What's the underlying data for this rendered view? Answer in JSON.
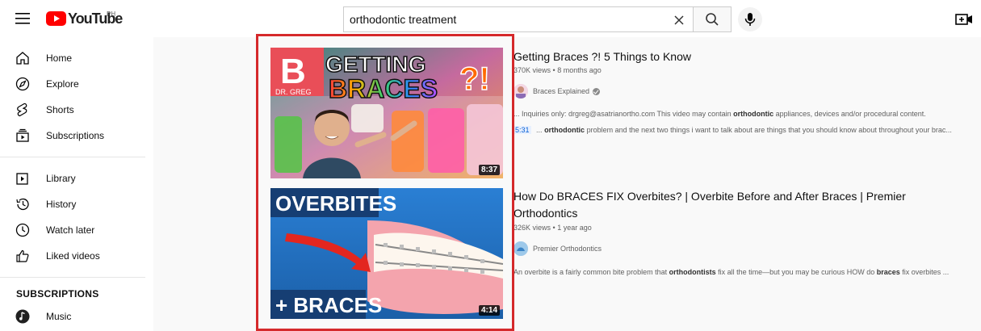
{
  "header": {
    "logo_text": "YouTube",
    "country_code": "PH",
    "search": {
      "value": "orthodontic treatment",
      "placeholder": "Search"
    }
  },
  "sidebar": {
    "main_items": [
      {
        "label": "Home",
        "icon": "home-icon"
      },
      {
        "label": "Explore",
        "icon": "compass-icon"
      },
      {
        "label": "Shorts",
        "icon": "shorts-icon"
      },
      {
        "label": "Subscriptions",
        "icon": "subscriptions-icon"
      }
    ],
    "library_items": [
      {
        "label": "Library",
        "icon": "library-icon"
      },
      {
        "label": "History",
        "icon": "history-icon"
      },
      {
        "label": "Watch later",
        "icon": "clock-icon"
      },
      {
        "label": "Liked videos",
        "icon": "thumbs-up-icon"
      }
    ],
    "subscriptions_title": "SUBSCRIPTIONS",
    "subscriptions": [
      {
        "label": "Music",
        "icon": "music-icon"
      }
    ]
  },
  "results": [
    {
      "title": "Getting Braces ?! 5 Things to Know",
      "views": "370K views",
      "age": "8 months ago",
      "channel": "Braces Explained",
      "verified": true,
      "duration": "8:37",
      "thumbnail_text_1": "GETTING",
      "thumbnail_text_2": "BRACES",
      "thumbnail_badge": "DR. GREG",
      "description": "... Inquiries only: drgreg@asatrianortho.com This video may contain",
      "description_bold": "orthodontic",
      "description_end": "appliances, devices and/or procedural content.",
      "chapter_time": "5:31",
      "chapter_pre": "...",
      "chapter_bold": "orthodontic",
      "chapter_text": "problem and the next two things i want to talk about are things that you should know about throughout your brac..."
    },
    {
      "title": "How Do BRACES FIX Overbites? | Overbite Before and After Braces | Premier Orthodontics",
      "views": "326K views",
      "age": "1 year ago",
      "channel": "Premier Orthodontics",
      "verified": false,
      "duration": "4:14",
      "thumbnail_text_1": "OVERBITES",
      "thumbnail_text_2": "+ BRACES",
      "description_pre": "An overbite is a fairly common bite problem that",
      "description_bold_1": "orthodontists",
      "description_mid": "fix all the time—but you may be curious HOW do",
      "description_bold_2": "braces",
      "description_end": "fix overbites ..."
    }
  ],
  "colors": {
    "brand_red": "#ff0000",
    "highlight_border": "#d5292b",
    "link_blue": "#065fd4"
  }
}
